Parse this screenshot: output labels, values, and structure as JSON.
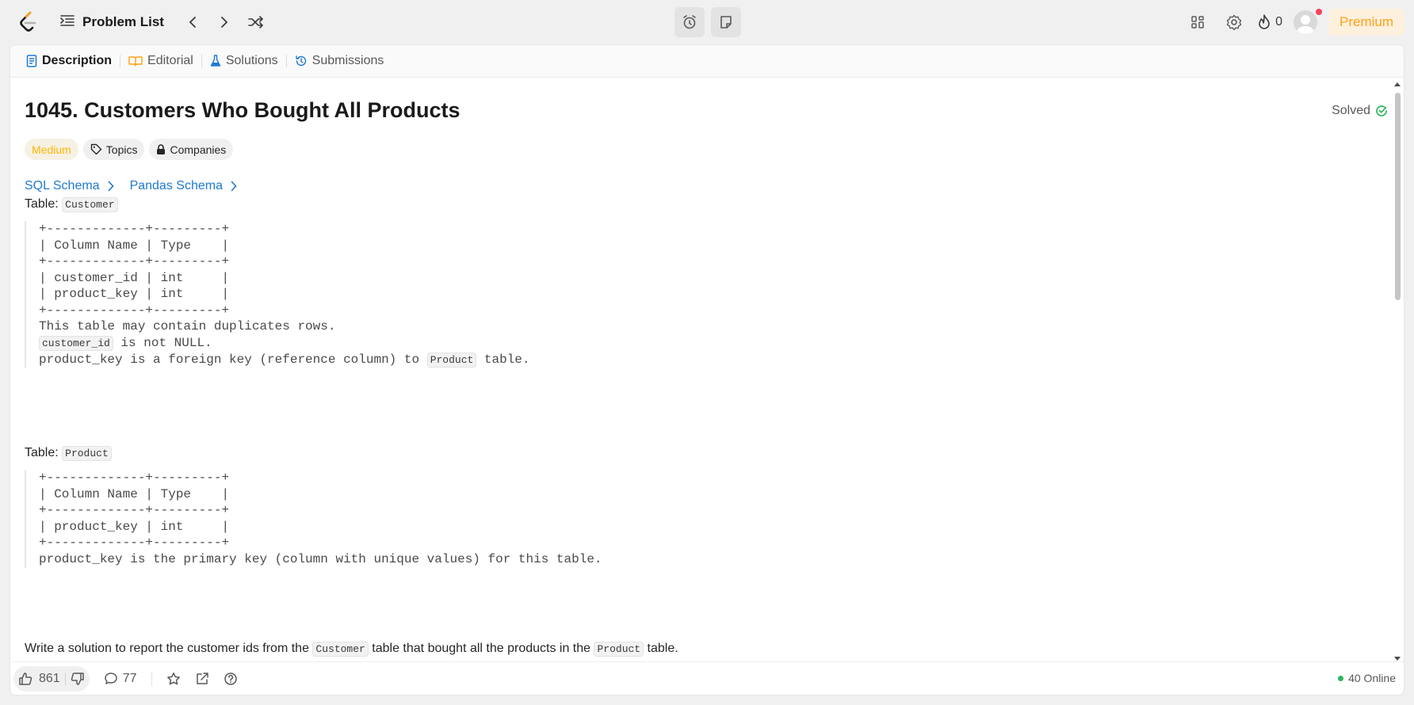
{
  "nav": {
    "problem_list_label": "Problem List",
    "streak_count": "0",
    "premium_label": "Premium"
  },
  "tabs": [
    {
      "label": "Description"
    },
    {
      "label": "Editorial"
    },
    {
      "label": "Solutions"
    },
    {
      "label": "Submissions"
    }
  ],
  "problem": {
    "title": "1045. Customers Who Bought All Products",
    "status": "Solved",
    "difficulty": "Medium",
    "topics_label": "Topics",
    "companies_label": "Companies",
    "sql_schema_label": "SQL Schema",
    "pandas_schema_label": "Pandas Schema",
    "table_prefix": "Table:",
    "customer_table": {
      "name": "Customer",
      "schema_lines": [
        "+-------------+---------+",
        "| Column Name | Type    |",
        "+-------------+---------+",
        "| customer_id | int     |",
        "| product_key | int     |",
        "+-------------+---------+"
      ],
      "note_1": "This table may contain duplicates rows.",
      "note_2_code": "customer_id",
      "note_2_rest": " is not NULL.",
      "note_3_pre": "product_key is a foreign key (reference column) to ",
      "note_3_code": "Product",
      "note_3_post": " table."
    },
    "product_table": {
      "name": "Product",
      "schema_lines": [
        "+-------------+---------+",
        "| Column Name | Type    |",
        "+-------------+---------+",
        "| product_key | int     |",
        "+-------------+---------+"
      ],
      "note_1": "product_key is the primary key (column with unique values) for this table."
    },
    "task": {
      "pre": "Write a solution to report the customer ids from the ",
      "code_1": "Customer",
      "mid": " table that bought all the products in the ",
      "code_2": "Product",
      "post": " table."
    }
  },
  "footer": {
    "likes": "861",
    "comments": "77",
    "online": "40 Online"
  },
  "colors": {
    "accent_orange": "#ffa116",
    "link_blue": "#1f7ad1",
    "solved_green": "#2db55d",
    "medium_yellow": "#ffb800"
  }
}
